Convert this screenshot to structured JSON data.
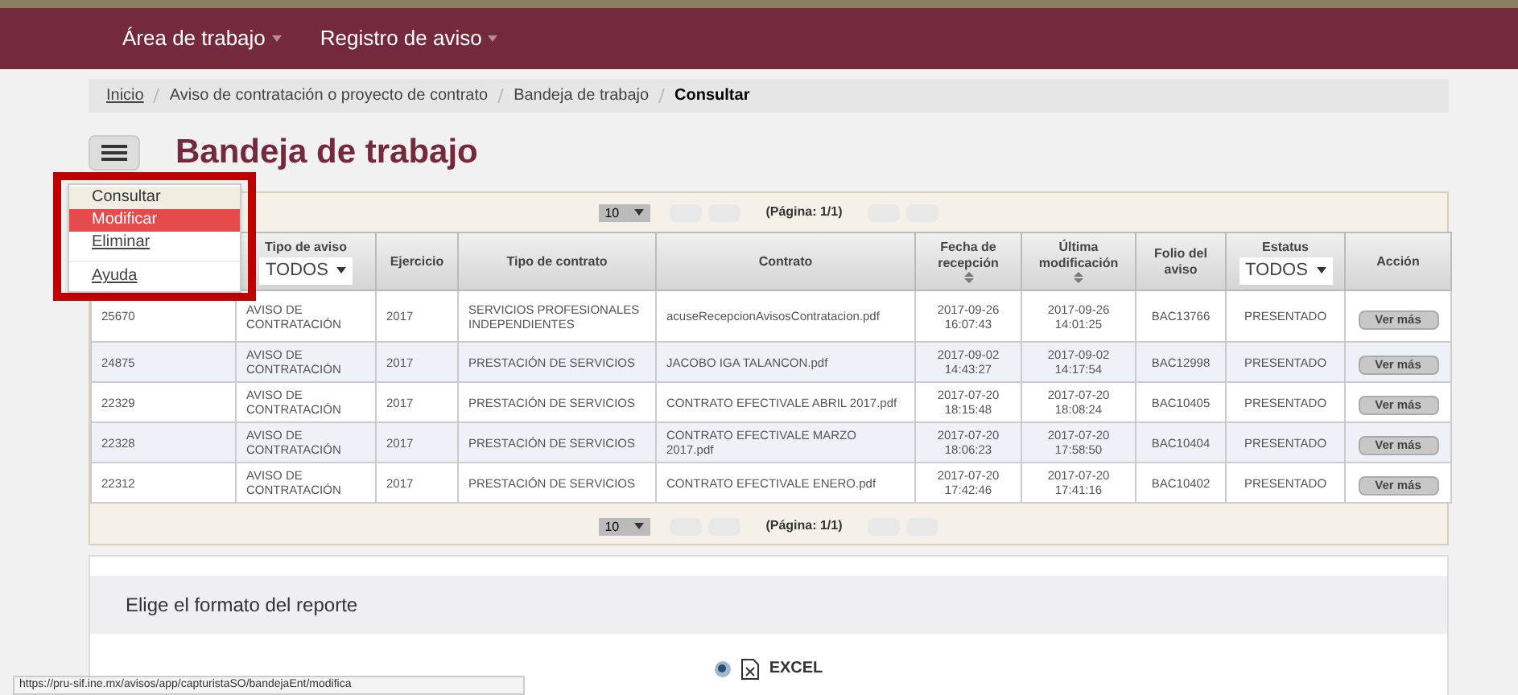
{
  "navbar": {
    "items": [
      {
        "label": "Área de trabajo"
      },
      {
        "label": "Registro de aviso"
      }
    ]
  },
  "breadcrumb": [
    {
      "label": "Inicio",
      "link": true
    },
    {
      "label": "Aviso de contratación o proyecto de contrato",
      "link": false
    },
    {
      "label": "Bandeja de trabajo",
      "link": false
    },
    {
      "label": "Consultar",
      "link": false
    }
  ],
  "title": "Bandeja de trabajo",
  "menu": {
    "groups": [
      [
        {
          "label": "Consultar",
          "hovered": false,
          "selected": true
        },
        {
          "label": "Modificar",
          "hovered": true,
          "selected": false
        },
        {
          "label": "Eliminar",
          "hovered": false,
          "selected": false
        }
      ],
      [
        {
          "label": "Ayuda",
          "hovered": false,
          "selected": false
        }
      ]
    ]
  },
  "pager_top": {
    "page_size": "10",
    "page_label": "(Página: 1/1)"
  },
  "table": {
    "columns": [
      null,
      {
        "label": "Tipo de aviso",
        "filter": "TODOS",
        "sortable": false
      },
      {
        "label": "Ejercicio",
        "sortable": false
      },
      {
        "label": "Tipo de contrato",
        "sortable": false
      },
      {
        "label": "Contrato",
        "sortable": false
      },
      {
        "label": "Fecha de recepción",
        "sortable": true
      },
      {
        "label": "Última modificación",
        "sortable": true
      },
      {
        "label": "Folio del aviso",
        "sortable": false
      },
      {
        "label": "Estatus",
        "filter": "TODOS",
        "sortable": false
      },
      {
        "label": "Acción",
        "sortable": false
      }
    ],
    "rows": [
      {
        "cells": [
          "25670",
          "AVISO DE CONTRATACIÓN",
          "2017",
          "SERVICIOS PROFESIONALES INDEPENDIENTES",
          "acuseRecepcionAvisosContratacion.pdf",
          "2017-09-26 16:07:43",
          "2017-09-26 14:01:25",
          "BAC13766",
          "PRESENTADO"
        ],
        "action": "Ver más"
      },
      {
        "cells": [
          "24875",
          "AVISO DE CONTRATACIÓN",
          "2017",
          "PRESTACIÓN DE SERVICIOS",
          "JACOBO IGA TALANCON.pdf",
          "2017-09-02 14:43:27",
          "2017-09-02 14:17:54",
          "BAC12998",
          "PRESENTADO"
        ],
        "action": "Ver más"
      },
      {
        "cells": [
          "22329",
          "AVISO DE CONTRATACIÓN",
          "2017",
          "PRESTACIÓN DE SERVICIOS",
          "CONTRATO EFECTIVALE ABRIL 2017.pdf",
          "2017-07-20 18:15:48",
          "2017-07-20 18:08:24",
          "BAC10405",
          "PRESENTADO"
        ],
        "action": "Ver más"
      },
      {
        "cells": [
          "22328",
          "AVISO DE CONTRATACIÓN",
          "2017",
          "PRESTACIÓN DE SERVICIOS",
          "CONTRATO EFECTIVALE MARZO 2017.pdf",
          "2017-07-20 18:06:23",
          "2017-07-20 17:58:50",
          "BAC10404",
          "PRESENTADO"
        ],
        "action": "Ver más"
      },
      {
        "cells": [
          "22312",
          "AVISO DE CONTRATACIÓN",
          "2017",
          "PRESTACIÓN DE SERVICIOS",
          "CONTRATO EFECTIVALE ENERO.pdf",
          "2017-07-20 17:42:46",
          "2017-07-20 17:41:16",
          "BAC10402",
          "PRESENTADO"
        ],
        "action": "Ver más"
      }
    ]
  },
  "pager_bottom": {
    "page_size": "10",
    "page_label": "(Página: 1/1)"
  },
  "report": {
    "heading": "Elige el formato del reporte",
    "options": [
      {
        "label": "EXCEL",
        "selected": true
      }
    ]
  },
  "status_url": "https://pru-sif.ine.mx/avisos/app/capturistaSO/bandejaEnt/modifica"
}
